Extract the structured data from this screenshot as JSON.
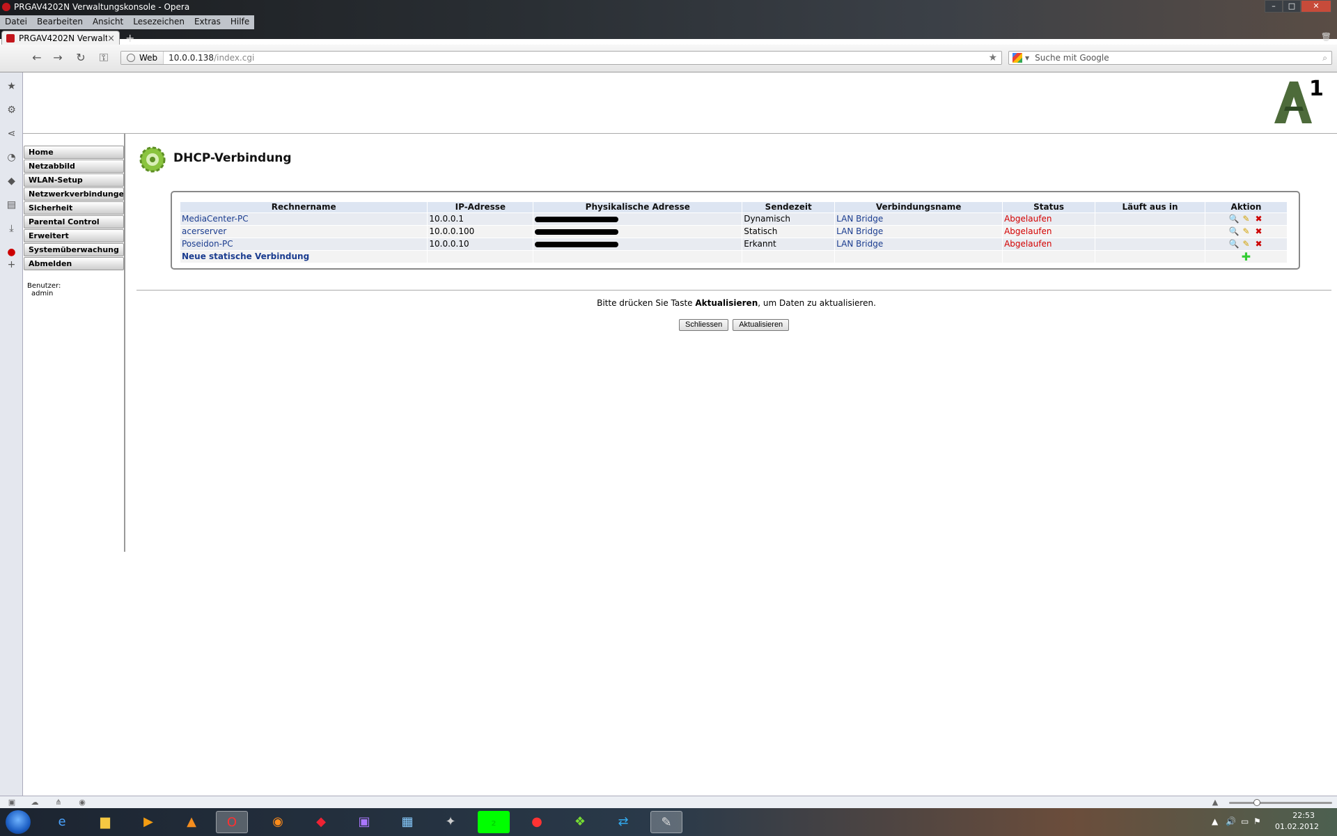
{
  "window": {
    "title": "PRGAV4202N Verwaltungskonsole - Opera"
  },
  "menu": [
    "Datei",
    "Bearbeiten",
    "Ansicht",
    "Lesezeichen",
    "Extras",
    "Hilfe"
  ],
  "tab": {
    "label": "PRGAV4202N Verwaltu...",
    "close": "×"
  },
  "address": {
    "badge": "Web",
    "host": "10.0.0.138",
    "path": "/index.cgi"
  },
  "search": {
    "placeholder": "Suche mit Google"
  },
  "nav": {
    "items": [
      "Home",
      "Netzabbild",
      "WLAN-Setup",
      "Netzwerkverbindungen",
      "Sicherheit",
      "Parental Control",
      "Erweitert",
      "Systemüberwachung",
      "Abmelden"
    ],
    "user_label": "Benutzer:",
    "user_name": "admin"
  },
  "page": {
    "title": "DHCP-Verbindung"
  },
  "table": {
    "headers": [
      "Rechnername",
      "IP-Adresse",
      "Physikalische Adresse",
      "Sendezeit",
      "Verbindungsname",
      "Status",
      "Läuft aus in",
      "Aktion"
    ],
    "rows": [
      {
        "host": "MediaCenter-PC",
        "ip": "10.0.0.1",
        "type": "Dynamisch",
        "conn": "LAN Bridge",
        "status": "Abgelaufen",
        "expires": ""
      },
      {
        "host": "acerserver",
        "ip": "10.0.0.100",
        "type": "Statisch",
        "conn": "LAN Bridge",
        "status": "Abgelaufen",
        "expires": ""
      },
      {
        "host": "Poseidon-PC",
        "ip": "10.0.0.10",
        "type": "Erkannt",
        "conn": "LAN Bridge",
        "status": "Abgelaufen",
        "expires": ""
      }
    ],
    "new_link": "Neue statische Verbindung"
  },
  "hint": {
    "before": "Bitte drücken Sie Taste ",
    "strong": "Aktualisieren",
    "after": ", um Daten zu aktualisieren."
  },
  "buttons": {
    "close": "Schliessen",
    "refresh": "Aktualisieren"
  },
  "clock": {
    "time": "22:53",
    "date": "01.02.2012"
  },
  "colors": {
    "status_expired": "#d40000",
    "link": "#1a3c8f"
  }
}
